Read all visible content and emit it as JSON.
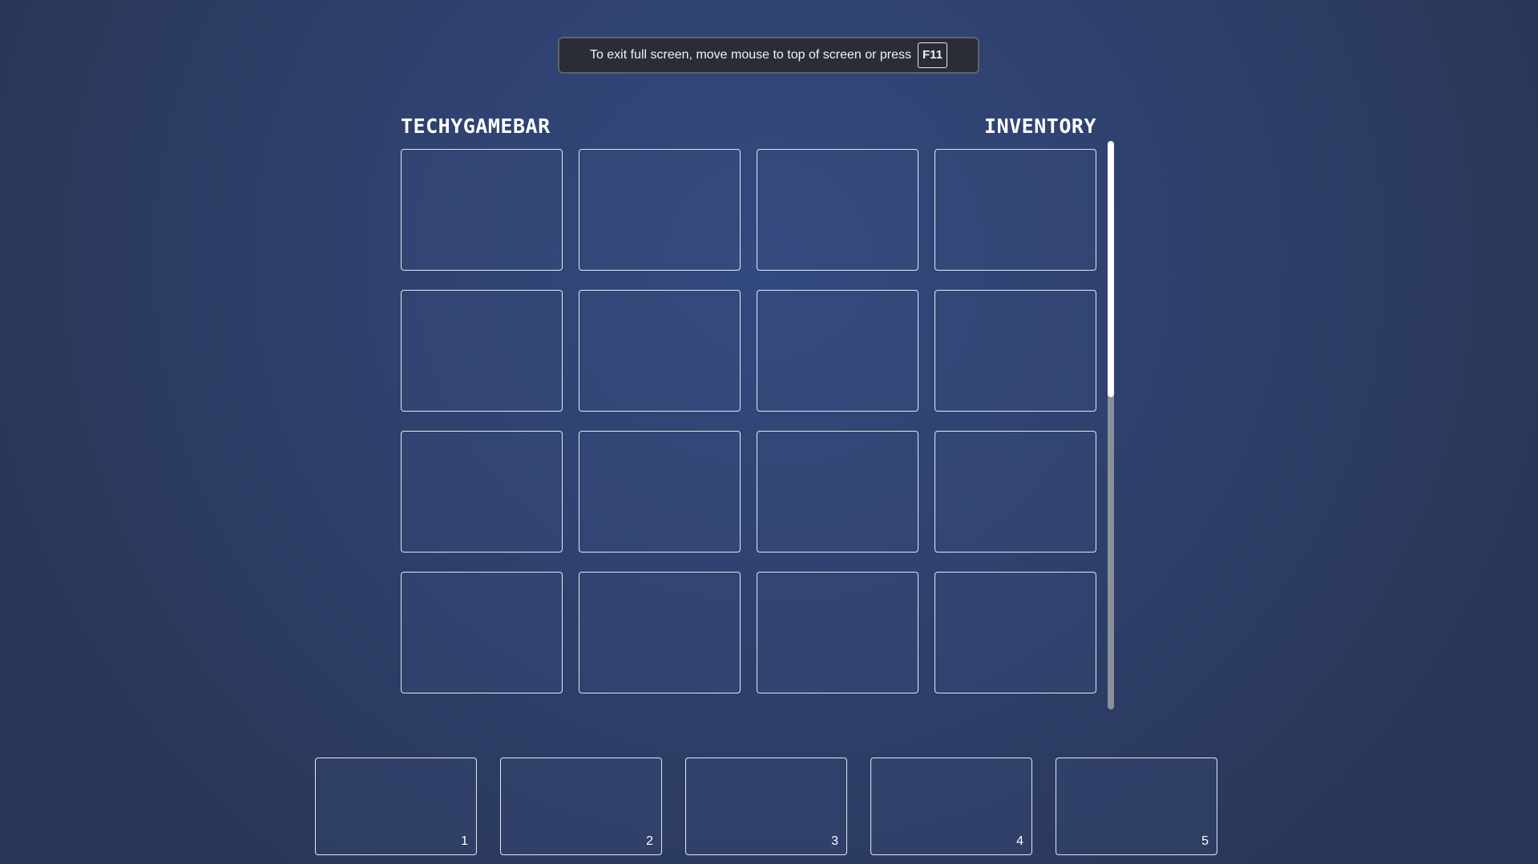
{
  "fullscreen_notice": {
    "text": "To exit full screen, move mouse to top of screen or press",
    "key": "F11"
  },
  "header": {
    "brand": "TECHYGAMEBAR",
    "title": "INVENTORY"
  },
  "inventory": {
    "rows": 4,
    "columns": 4,
    "slots_filled": 0
  },
  "hotbar": {
    "slots": [
      {
        "label": "1"
      },
      {
        "label": "2"
      },
      {
        "label": "3"
      },
      {
        "label": "4"
      },
      {
        "label": "5"
      }
    ]
  },
  "colors": {
    "background": "#2f416e",
    "slot_border": "#e4e7f0",
    "notice_background": "#2a2d36",
    "scrollbar_track": "#8a8f99",
    "scrollbar_thumb": "#ffffff"
  }
}
